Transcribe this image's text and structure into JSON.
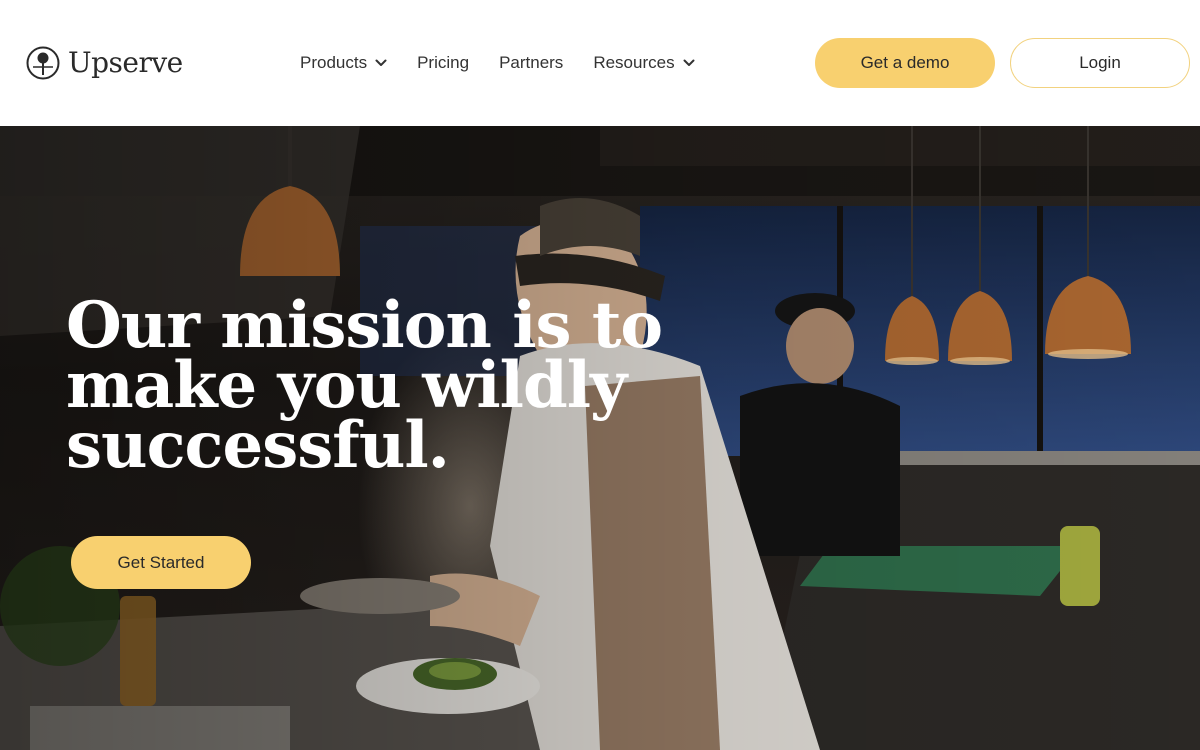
{
  "brand": {
    "name": "Upserve",
    "logo_icon": "upserve-pin-icon"
  },
  "nav": {
    "items": [
      {
        "label": "Products",
        "has_dropdown": true
      },
      {
        "label": "Pricing",
        "has_dropdown": false
      },
      {
        "label": "Partners",
        "has_dropdown": false
      },
      {
        "label": "Resources",
        "has_dropdown": true
      }
    ]
  },
  "header": {
    "demo_label": "Get a demo",
    "login_label": "Login"
  },
  "hero": {
    "headline": "Our mission is to make you wildly successful.",
    "cta_label": "Get Started",
    "image_subject": "chefs plating food in a restaurant kitchen"
  },
  "colors": {
    "accent": "#f8d06f",
    "login_border": "#f2d27f",
    "text_dark": "#2a2a2a",
    "hero_text": "#ffffff"
  }
}
